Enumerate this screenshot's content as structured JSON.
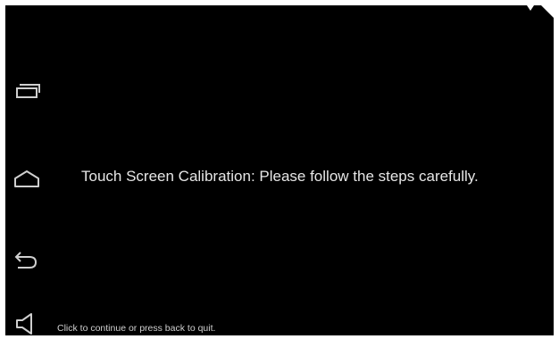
{
  "screen": {
    "background": "#000000",
    "message": "Touch Screen Calibration: Please follow the steps carefully.",
    "hint": "Click to continue or press back to quit."
  },
  "navigation_bar": {
    "buttons": [
      {
        "name": "recent-apps",
        "icon": "recent-apps-icon"
      },
      {
        "name": "home",
        "icon": "home-icon"
      },
      {
        "name": "back",
        "icon": "back-icon"
      },
      {
        "name": "volume",
        "icon": "volume-icon"
      }
    ],
    "icon_color": "#cfcfcf"
  }
}
